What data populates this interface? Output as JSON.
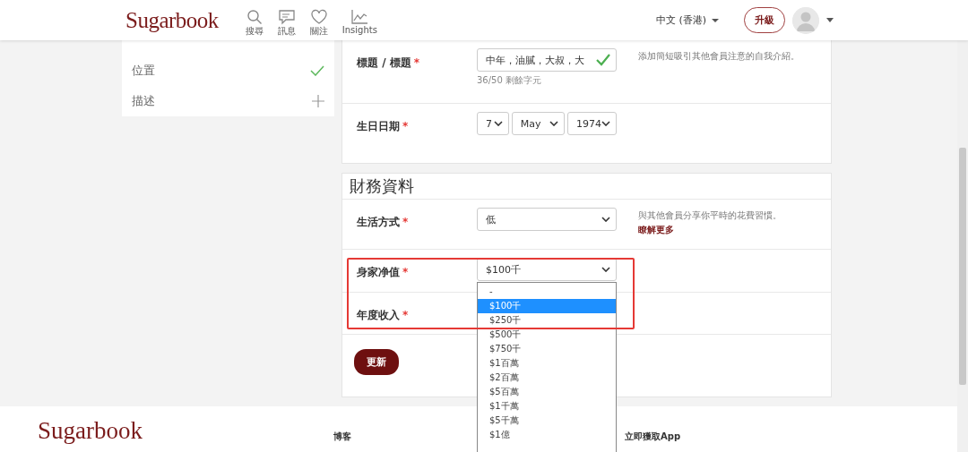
{
  "header": {
    "logo": "Sugarbook",
    "nav": [
      {
        "label": "搜尋"
      },
      {
        "label": "訊息"
      },
      {
        "label": "關注"
      },
      {
        "label": "Insights"
      }
    ],
    "language": "中文 (香港)",
    "upgrade_button": "升級"
  },
  "sidebar": {
    "items": [
      {
        "label": "位置",
        "completed": true
      },
      {
        "label": "描述",
        "completed": false
      }
    ]
  },
  "profile_section": {
    "fields": [
      {
        "kind": "text",
        "label": "標題 / 標題",
        "mark": "*",
        "value": "中年，油膩，大叔，大",
        "valid": true,
        "counter": "36/50 剩餘字元",
        "hint": "添加簡短吸引其他會員注意的自我介紹。"
      },
      {
        "kind": "date",
        "label": "生日日期",
        "mark": "*",
        "selects": [
          "7",
          "May",
          "1974"
        ]
      }
    ]
  },
  "finance_section": {
    "title": "財務資料",
    "fields": [
      {
        "kind": "select",
        "label": "生活方式",
        "mark": "*",
        "value": "低",
        "hint": "與其他會員分享你平時的花費習慣。",
        "link": "瞭解更多"
      },
      {
        "kind": "select",
        "label": "身家净值",
        "mark": "*",
        "value": "$100千",
        "open": true,
        "options": [
          {
            "label": "-",
            "selected": false
          },
          {
            "label": "$100千",
            "selected": true
          },
          {
            "label": "$250千",
            "selected": false
          },
          {
            "label": "$500千",
            "selected": false
          },
          {
            "label": "$750千",
            "selected": false
          },
          {
            "label": "$1百萬",
            "selected": false
          },
          {
            "label": "$2百萬",
            "selected": false
          },
          {
            "label": "$5百萬",
            "selected": false
          },
          {
            "label": "$1千萬",
            "selected": false
          },
          {
            "label": "$5千萬",
            "selected": false
          },
          {
            "label": "$1億",
            "selected": false
          }
        ]
      },
      {
        "kind": "select",
        "label": "年度收入",
        "mark": "*"
      }
    ],
    "update_button": "更新"
  },
  "footer": {
    "logo": "Sugarbook",
    "links": [
      "博客",
      "立即獲取App"
    ]
  }
}
